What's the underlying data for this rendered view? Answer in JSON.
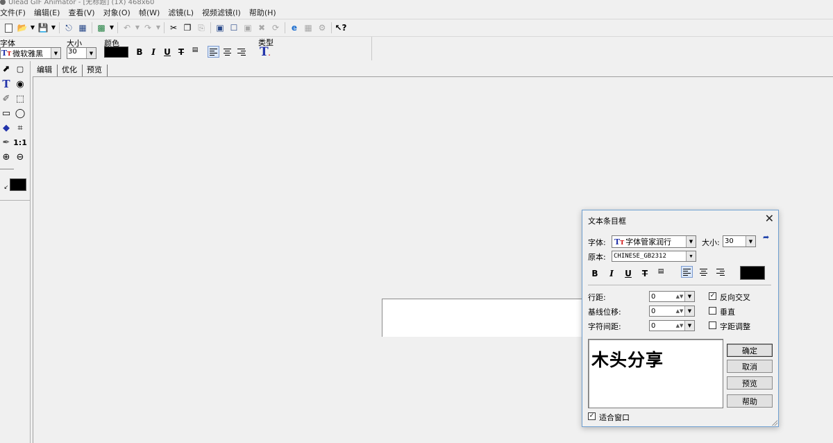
{
  "window": {
    "title": "Ulead GIF Animator - [无标题] (1X) 468x60"
  },
  "menu": [
    "文件(F)",
    "编辑(E)",
    "查看(V)",
    "对象(O)",
    "帧(W)",
    "滤镜(L)",
    "视频滤镜(I)",
    "帮助(H)"
  ],
  "props": {
    "font_label": "字体",
    "font_value": "微软雅黑",
    "size_label": "大小",
    "size_value": "30",
    "color_label": "颜色",
    "color_value": "#000000",
    "type_label": "类型",
    "bold": "B",
    "italic": "I",
    "underline": "U",
    "strike": "T"
  },
  "tabs": [
    "编辑",
    "优化",
    "预览"
  ],
  "dialog": {
    "title": "文本条目框",
    "font_label": "字体:",
    "font_value": "字体管家润行",
    "size_label": "大小:",
    "size_value": "30",
    "script_label": "原本:",
    "script_value": "CHINESE_GB2312",
    "color_value": "#000000",
    "line_spacing_label": "行距:",
    "line_spacing_value": "0",
    "baseline_label": "基线位移:",
    "baseline_value": "0",
    "char_spacing_label": "字符间距:",
    "char_spacing_value": "0",
    "reverse_label": "反向交叉",
    "reverse_checked": true,
    "vertical_label": "垂直",
    "vertical_checked": false,
    "kerning_label": "字距调整",
    "kerning_checked": false,
    "preview_text": "木头分享",
    "ok_label": "确定",
    "cancel_label": "取消",
    "preview_label": "预览",
    "help_label": "帮助",
    "fit_label": "适合窗口",
    "fit_checked": true
  }
}
